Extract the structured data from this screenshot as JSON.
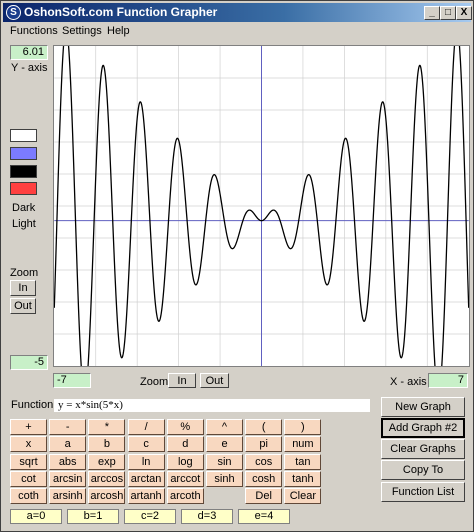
{
  "window": {
    "title": "OshonSoft.com Function Grapher",
    "icon_letter": "S",
    "controls": [
      "_",
      "□",
      "X"
    ]
  },
  "menu": [
    "Functions",
    "Settings",
    "Help"
  ],
  "left_panel": {
    "y_max": "6.01",
    "y_axis_label": "Y - axis",
    "swatches": [
      "#ffffff",
      "#7b7bff",
      "#000000",
      "#ff4040"
    ],
    "dark_label": "Dark",
    "light_label": "Light",
    "zoom_label": "Zoom",
    "zoom_in": "In",
    "zoom_out": "Out",
    "y_min": "-5"
  },
  "bottom_axis": {
    "x_min": "-7",
    "zoom_label": "Zoom",
    "zoom_in": "In",
    "zoom_out": "Out",
    "x_axis_label": "X - axis",
    "x_max": "7"
  },
  "function_row": {
    "label": "Function:",
    "value": "y = x*sin(5*x)"
  },
  "keypad": [
    [
      "+",
      "-",
      "*",
      "/",
      "%",
      "^",
      "(",
      ")"
    ],
    [
      "x",
      "a",
      "b",
      "c",
      "d",
      "e",
      "pi",
      "num"
    ],
    [
      "sqrt",
      "abs",
      "exp",
      "ln",
      "log",
      "sin",
      "cos",
      "tan"
    ],
    [
      "cot",
      "arcsin",
      "arccos",
      "arctan",
      "arccot",
      "sinh",
      "cosh",
      "tanh"
    ],
    [
      "coth",
      "arsinh",
      "arcosh",
      "artanh",
      "arcoth",
      "",
      "Del",
      "Clear"
    ]
  ],
  "side_buttons": [
    "New Graph",
    "Add Graph #2",
    "Clear Graphs",
    "Copy To Clipboard",
    "Function List"
  ],
  "variables": [
    "a=0",
    "b=1",
    "c=2",
    "d=3",
    "e=4"
  ],
  "colors": {
    "grid": "#d0d0d0",
    "axes": "#6060c0",
    "curve": "#000000",
    "value_box": "#c8f0c8",
    "keypad": "#f8d8c0",
    "variable_box": "#ffffc8"
  },
  "chart_data": {
    "type": "line",
    "function": "y = x*sin(5*x)",
    "xlim": [
      -7,
      7
    ],
    "ylim": [
      -5,
      6.01
    ],
    "grid": true,
    "gridlines": 10
  }
}
